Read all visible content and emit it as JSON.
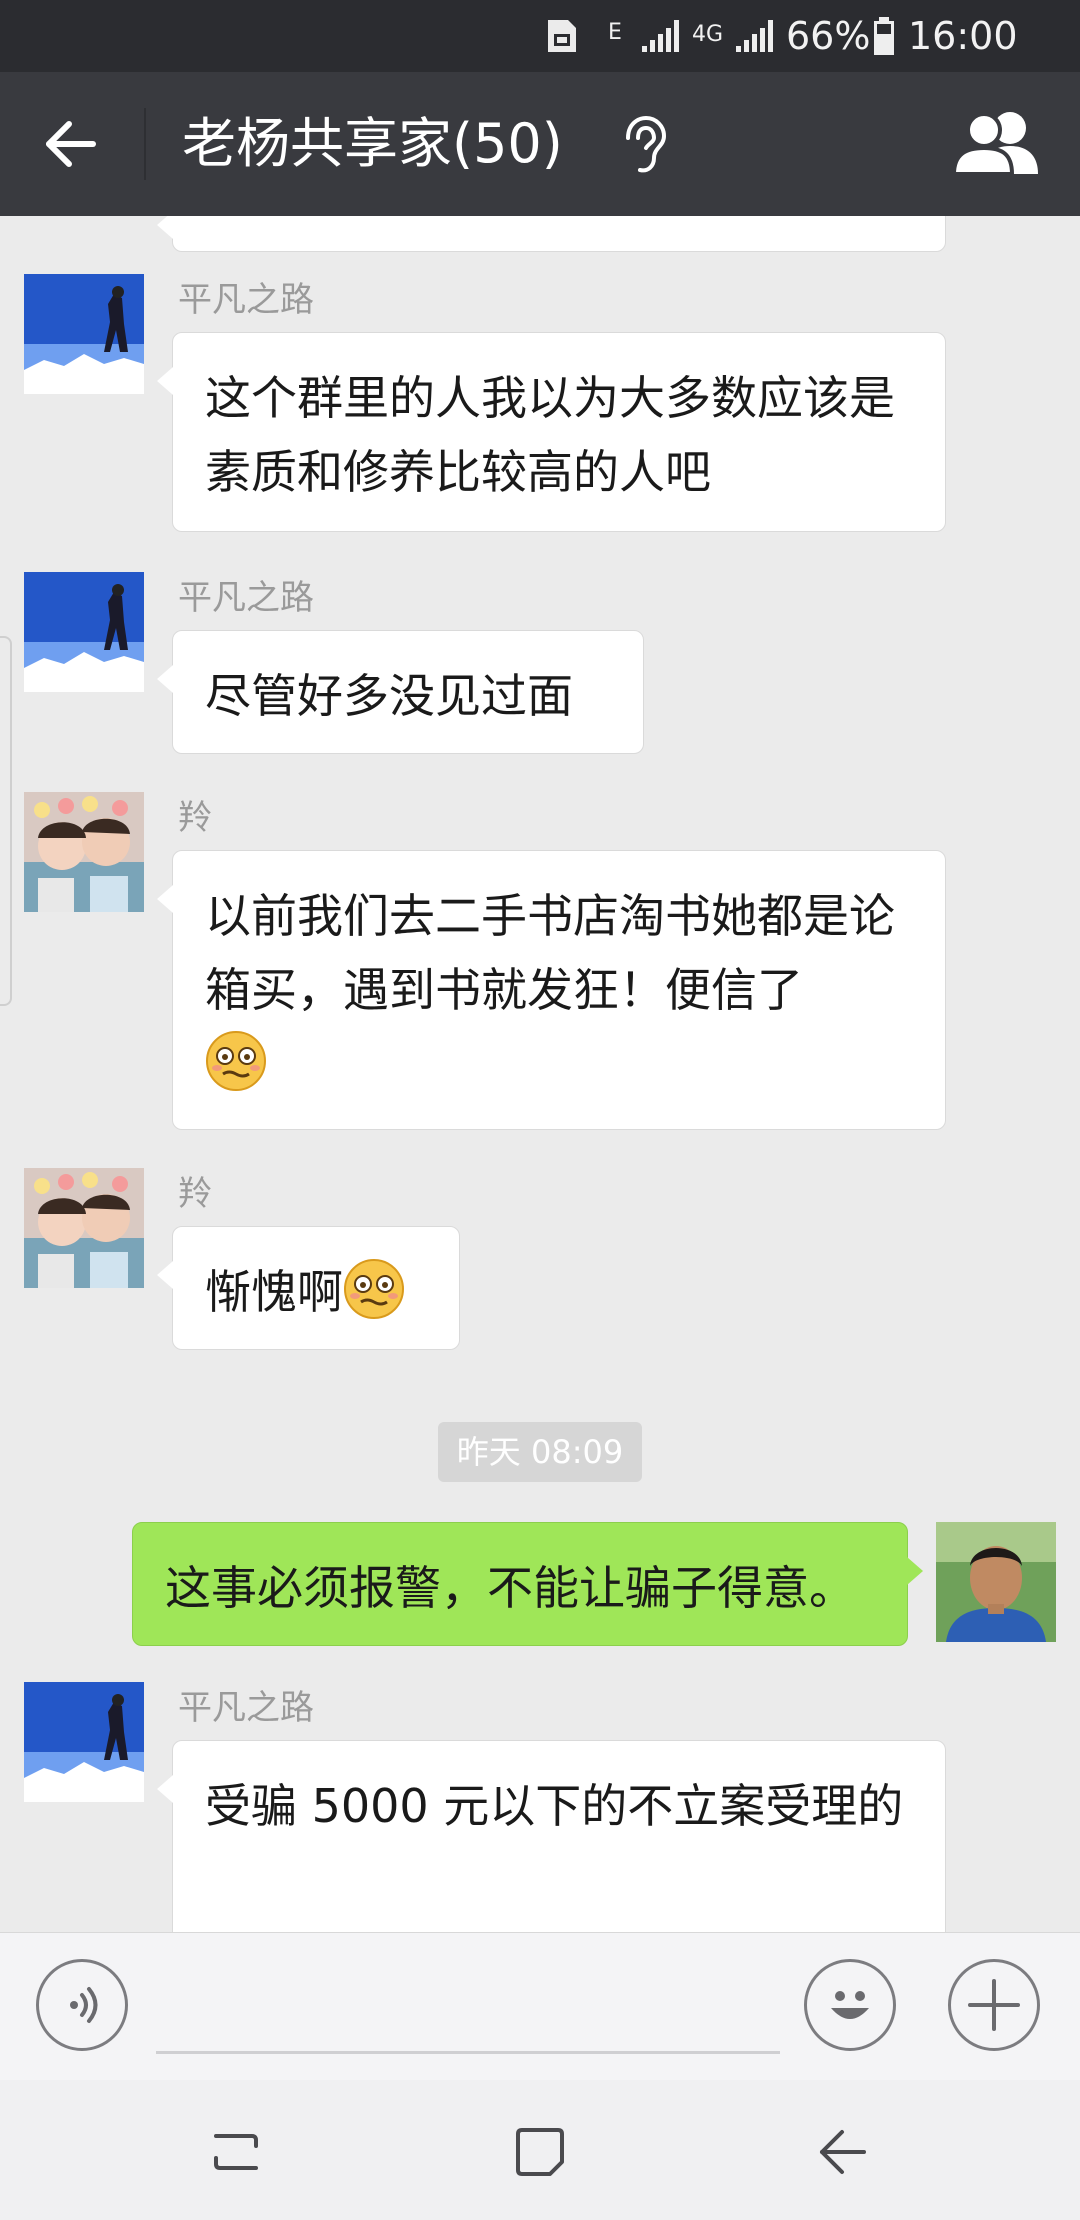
{
  "status_bar": {
    "signal_type_1": "E",
    "signal_type_2": "4G",
    "battery": "66%",
    "time": "16:00"
  },
  "header": {
    "title": "老杨共享家(50)",
    "icons": [
      "back-arrow-icon",
      "ear-icon",
      "group-members-icon"
    ]
  },
  "messages": [
    {
      "sender": "平凡之路",
      "text": "这个群里的人我以为大多数应该是素质和修养比较高的人吧",
      "direction": "incoming"
    },
    {
      "sender": "平凡之路",
      "text": "尽管好多没见过面",
      "direction": "incoming"
    },
    {
      "sender": "羚",
      "text": "以前我们去二手书店淘书她都是论箱买，遇到书就发狂！便信了",
      "emoji": "embarrassed-face-icon",
      "direction": "incoming"
    },
    {
      "sender": "羚",
      "text": "惭愧啊",
      "emoji": "embarrassed-face-icon",
      "direction": "incoming"
    },
    {
      "timestamp": "昨天 08:09"
    },
    {
      "text": "这事必须报警，不能让骗子得意。",
      "direction": "outgoing"
    },
    {
      "sender": "平凡之路",
      "text": "受骗 5000 元以下的不立案受理的",
      "direction": "incoming"
    }
  ],
  "input_bar": {
    "icons": [
      "voice-input-icon",
      "emoji-icon",
      "add-icon"
    ]
  },
  "nav_bar": {
    "icons": [
      "recent-apps-icon",
      "home-icon",
      "back-icon"
    ]
  },
  "colors": {
    "title_bar": "#393a3f",
    "status_bar": "#2b2c30",
    "chat_background": "#ebebeb",
    "outgoing_bubble": "#9fe658",
    "incoming_bubble": "#ffffff"
  }
}
